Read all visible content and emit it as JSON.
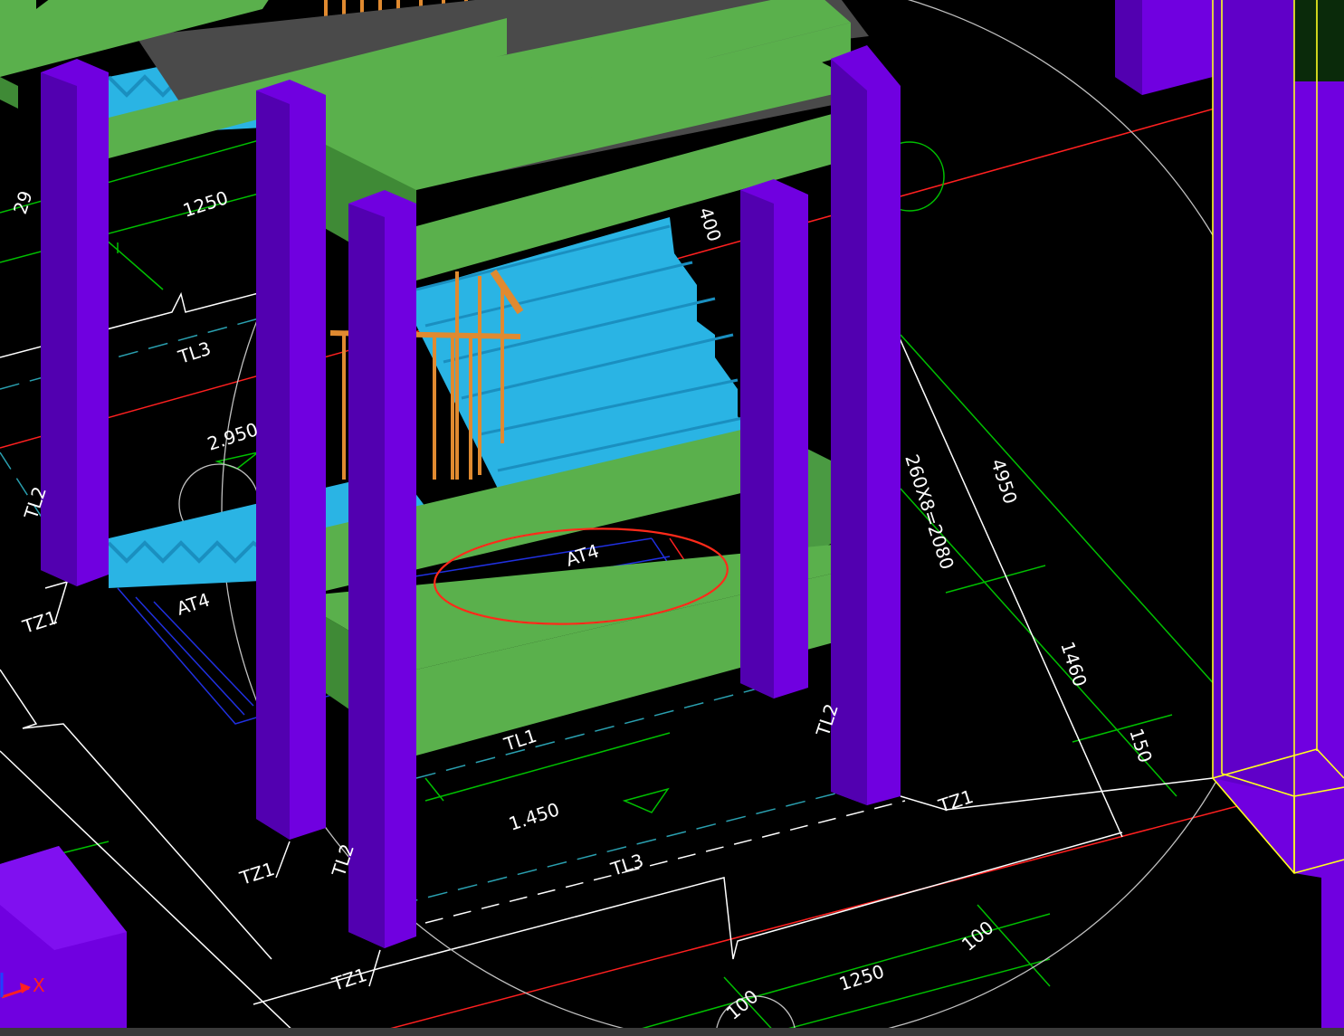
{
  "colors": {
    "background": "#000000",
    "column": "#7000e0",
    "column_dark": "#5200b0",
    "beam": "#5ab04c",
    "beam_dark": "#3f8a36",
    "slab": "#4a4a4a",
    "stair": "#2ab4e4",
    "stair_dark": "#1a8fc0",
    "railing": "#e08a30",
    "cad_line": "#ffffff",
    "cad_green": "#00c000",
    "cad_red": "#ff2020",
    "cad_cyan": "#2aa0b0",
    "cad_blue": "#2030e0",
    "highlight_ellipse": "#ff2a1a",
    "selection_box": "#ffff20"
  },
  "labels": {
    "dim_1250_top": "1250",
    "dim_29": "29",
    "tl3_upper": "TL3",
    "elev_2950": "2.950",
    "tl2_left": "TL2",
    "tz1_left": "TZ1",
    "at4_left": "AT4",
    "at4_center": "AT4",
    "dim_400": "400",
    "stair_formula": "260X8=2080",
    "dim_4950": "4950",
    "dim_1460": "1460",
    "dim_150": "150",
    "tl1": "TL1",
    "elev_1450": "1.450",
    "tl2_mid": "TL2",
    "tl2_right": "TL2",
    "tz1_mid": "TZ1",
    "tz1_right": "TZ1",
    "tl3_lower": "TL3",
    "tz1_bottom": "TZ1",
    "dim_100_right": "100",
    "dim_1250_bottom": "1250",
    "dim_100_bottom": "100",
    "axis_x": "X"
  },
  "icons": [
    "ucs-axis-icon"
  ]
}
